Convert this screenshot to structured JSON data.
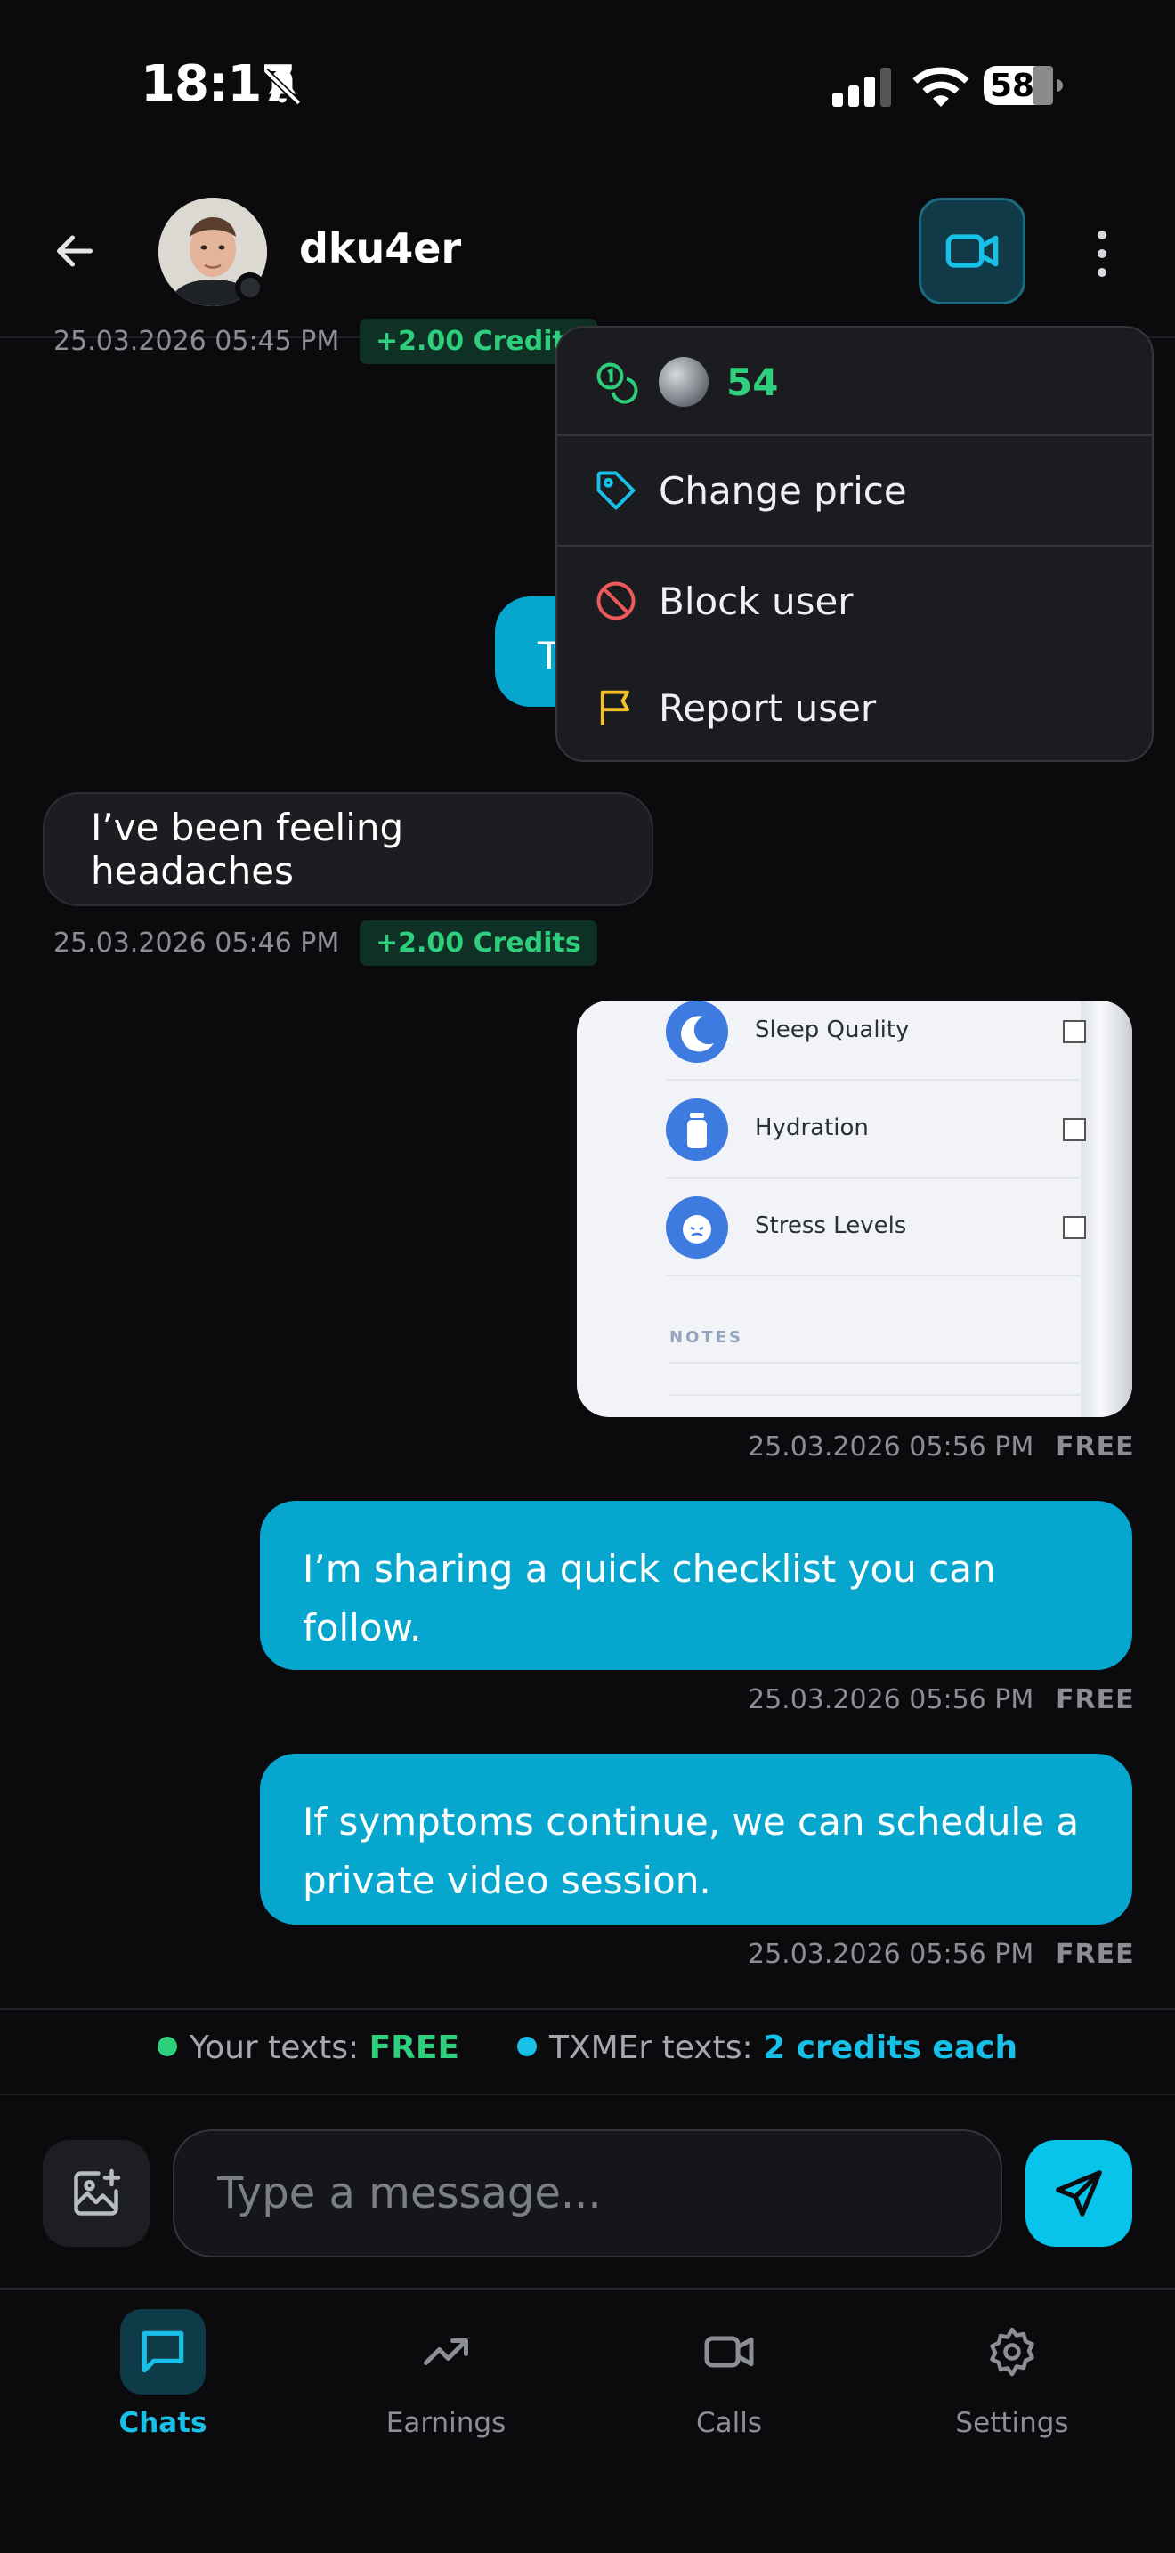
{
  "status_bar": {
    "time": "18:17",
    "battery": "58"
  },
  "header": {
    "contact_name": "dku4er"
  },
  "menu": {
    "credits": "54",
    "items": [
      {
        "label": "Change price",
        "icon": "tag-icon"
      },
      {
        "label": "Block user",
        "icon": "block-icon"
      },
      {
        "label": "Report user",
        "icon": "flag-icon"
      }
    ]
  },
  "messages": [
    {
      "direction": "in",
      "timestamp": "25.03.2026 05:45 PM",
      "badge": "+2.00 Credits"
    },
    {
      "direction": "out",
      "text": "T"
    },
    {
      "direction": "in",
      "text": "I’ve been feeling headaches",
      "timestamp": "25.03.2026 05:46 PM",
      "badge": "+2.00 Credits"
    },
    {
      "direction": "out",
      "type": "image",
      "timestamp": "25.03.2026 05:56 PM",
      "price": "FREE",
      "image": {
        "rows": [
          "Sleep Quality",
          "Hydration",
          "Stress Levels"
        ],
        "notes_label": "NOTES"
      }
    },
    {
      "direction": "out",
      "text": "I’m sharing a quick checklist you can follow.",
      "timestamp": "25.03.2026 05:56 PM",
      "price": "FREE"
    },
    {
      "direction": "out",
      "text": "If symptoms continue, we can schedule a private video session.",
      "timestamp": "25.03.2026 05:56 PM",
      "price": "FREE"
    }
  ],
  "info": {
    "your_label": "Your texts:",
    "your_value": "FREE",
    "their_label": "TXMEr texts:",
    "their_value": "2 credits each"
  },
  "composer": {
    "placeholder": "Type a message..."
  },
  "tabs": [
    {
      "label": "Chats",
      "active": true
    },
    {
      "label": "Earnings",
      "active": false
    },
    {
      "label": "Calls",
      "active": false
    },
    {
      "label": "Settings",
      "active": false
    }
  ],
  "colors": {
    "accent": "#08c3ea",
    "bubble_out": "#06a6cf",
    "credit_green": "#2ecf7c",
    "background": "#0b0b0e"
  }
}
